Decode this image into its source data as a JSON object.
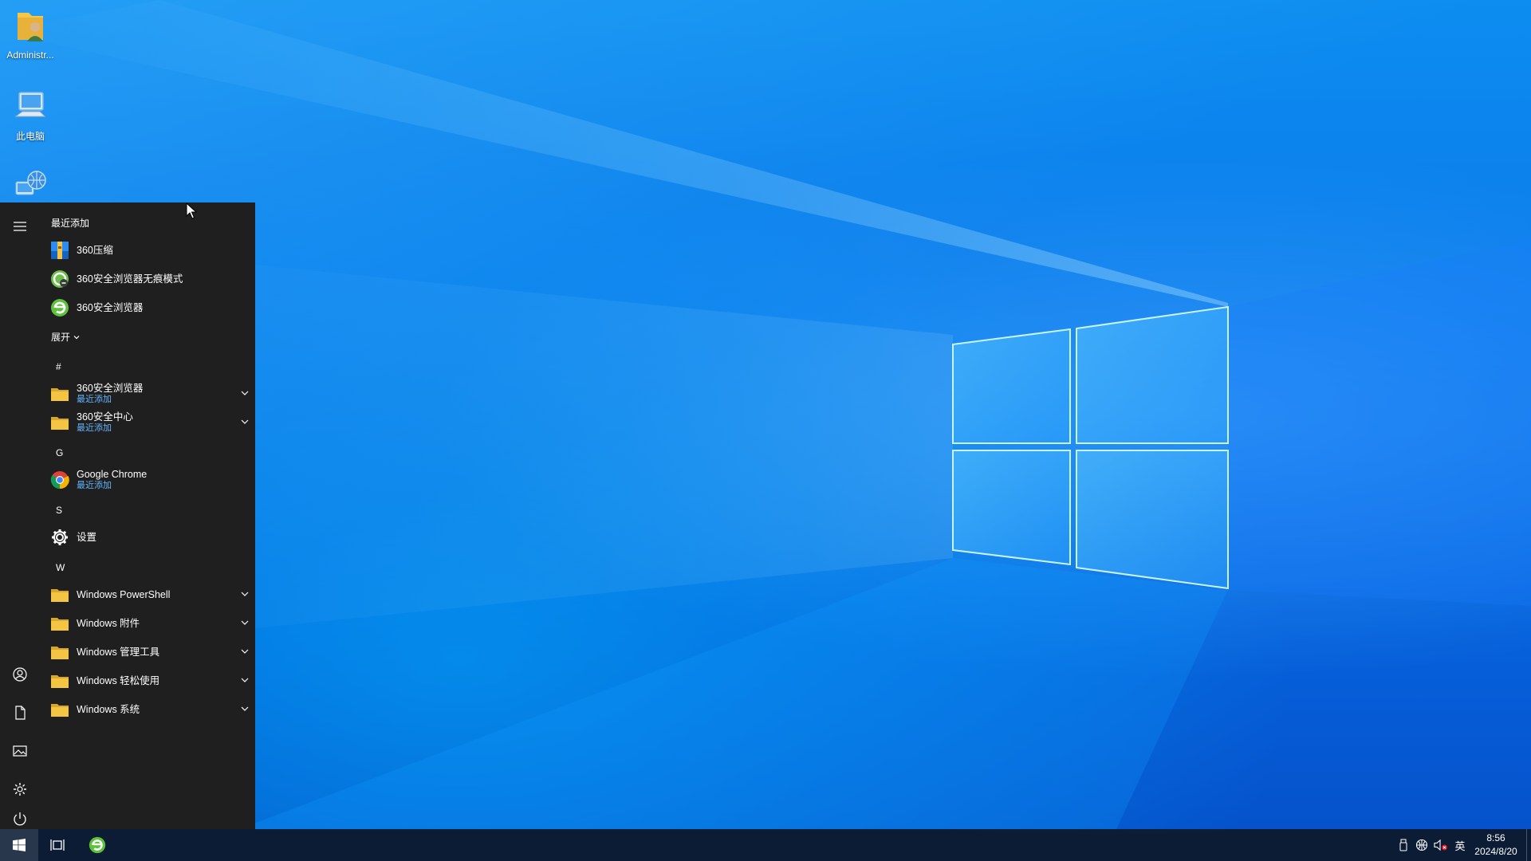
{
  "desktop": {
    "icons": [
      {
        "label": "Administr...",
        "icon": "user-folder-icon"
      },
      {
        "label": "此电脑",
        "icon": "computer-icon"
      },
      {
        "label": "",
        "icon": "network-icon"
      }
    ]
  },
  "start_menu": {
    "recent_title": "最近添加",
    "recent": [
      {
        "name": "360压缩",
        "icon": "zip-360-icon"
      },
      {
        "name": "360安全浏览器无痕模式",
        "icon": "browser-360-private-icon"
      },
      {
        "name": "360安全浏览器",
        "icon": "browser-360-icon"
      }
    ],
    "expand_label": "展开",
    "groups": [
      {
        "letter": "#",
        "items": [
          {
            "name": "360安全浏览器",
            "sub": "最近添加",
            "icon": "folder-icon",
            "expandable": true
          },
          {
            "name": "360安全中心",
            "sub": "最近添加",
            "icon": "folder-icon",
            "expandable": true
          }
        ]
      },
      {
        "letter": "G",
        "items": [
          {
            "name": "Google Chrome",
            "sub": "最近添加",
            "icon": "chrome-icon",
            "expandable": false
          }
        ]
      },
      {
        "letter": "S",
        "items": [
          {
            "name": "设置",
            "sub": "",
            "icon": "gear-icon",
            "expandable": false
          }
        ]
      },
      {
        "letter": "W",
        "items": [
          {
            "name": "Windows PowerShell",
            "sub": "",
            "icon": "folder-icon",
            "expandable": true
          },
          {
            "name": "Windows 附件",
            "sub": "",
            "icon": "folder-icon",
            "expandable": true
          },
          {
            "name": "Windows 管理工具",
            "sub": "",
            "icon": "folder-icon",
            "expandable": true
          },
          {
            "name": "Windows 轻松使用",
            "sub": "",
            "icon": "folder-icon",
            "expandable": true
          },
          {
            "name": "Windows 系统",
            "sub": "",
            "icon": "folder-icon",
            "expandable": true
          }
        ]
      }
    ],
    "rail": [
      "hamburger-icon",
      "user-icon",
      "document-icon",
      "pictures-icon",
      "settings-icon",
      "power-icon"
    ]
  },
  "taskbar": {
    "tray": {
      "input_indicator": "英",
      "time": "8:56",
      "date": "2024/8/20"
    }
  },
  "colors": {
    "start_bg": "#1f1f1f",
    "accent_sub": "#64b5ff",
    "folder": "#f4c542"
  }
}
